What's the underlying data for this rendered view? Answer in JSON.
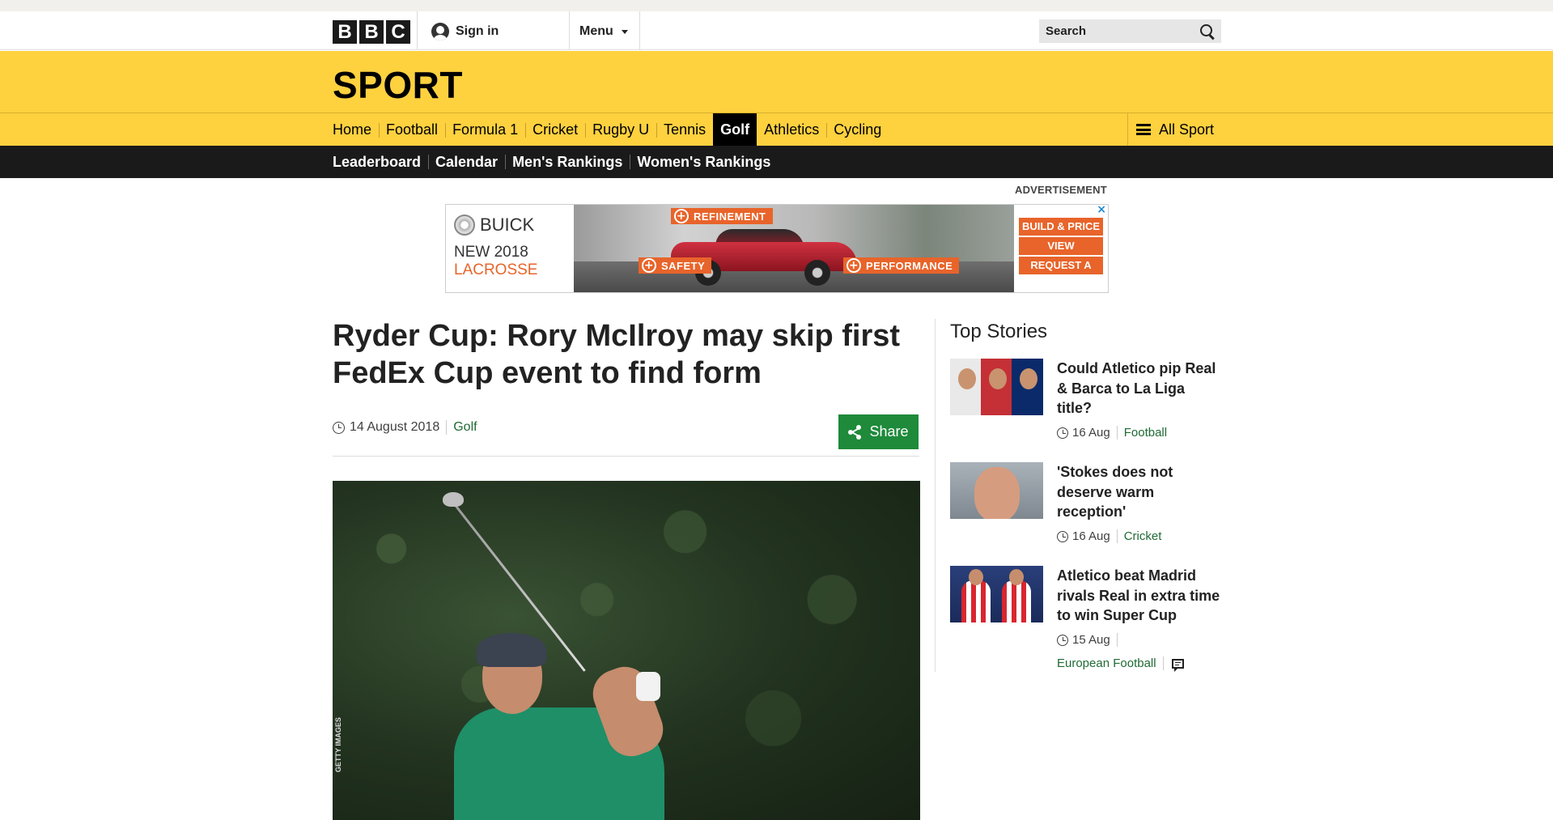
{
  "header": {
    "logo_letters": [
      "B",
      "B",
      "C"
    ],
    "sign_in_label": "Sign in",
    "menu_label": "Menu",
    "search_placeholder": "Search"
  },
  "sport": {
    "title": "SPORT",
    "nav": [
      "Home",
      "Football",
      "Formula 1",
      "Cricket",
      "Rugby U",
      "Tennis",
      "Golf",
      "Athletics",
      "Cycling"
    ],
    "active_nav": "Golf",
    "all_sport_label": "All Sport",
    "subnav": [
      "Leaderboard",
      "Calendar",
      "Men's Rankings",
      "Women's Rankings"
    ]
  },
  "advert": {
    "label": "ADVERTISEMENT",
    "brand": "BUICK",
    "line1": "NEW 2018",
    "line2": "LACROSSE",
    "features": [
      "REFINEMENT",
      "SAFETY",
      "PERFORMANCE"
    ],
    "buttons": [
      "BUILD & PRICE",
      "VIEW",
      "REQUEST A"
    ],
    "close_glyph": "×",
    "accent": "#e8642a"
  },
  "article": {
    "headline": "Ryder Cup: Rory McIlroy may skip first FedEx Cup event to find form",
    "date": "14 August 2018",
    "section": "Golf",
    "share_label": "Share",
    "image_credit": "GETTY IMAGES"
  },
  "top_stories": {
    "heading": "Top Stories",
    "items": [
      {
        "title": "Could Atletico pip Real & Barca to La Liga title?",
        "date": "16 Aug",
        "section": "Football"
      },
      {
        "title": "'Stokes does not deserve warm reception'",
        "date": "16 Aug",
        "section": "Cricket"
      },
      {
        "title": "Atletico beat Madrid rivals Real in extra time to win Super Cup",
        "date": "15 Aug",
        "section": "European Football"
      }
    ]
  },
  "colors": {
    "sport_yellow": "#fed13f",
    "black": "#1a1a1a",
    "share_green": "#1e8a3a",
    "link_green": "#1f6b35"
  }
}
